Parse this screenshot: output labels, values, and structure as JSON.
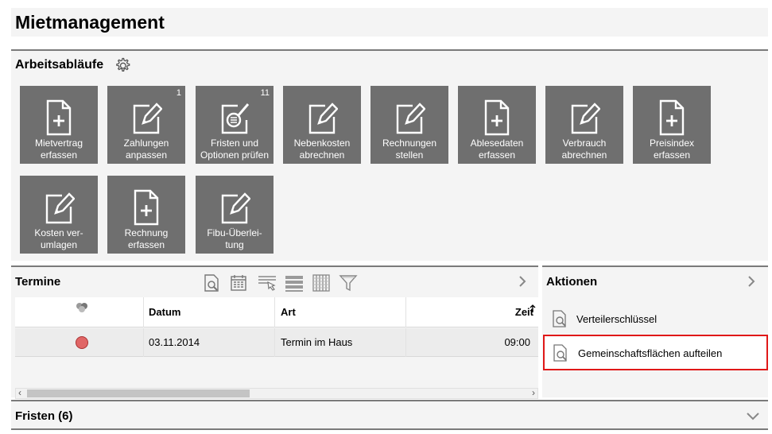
{
  "page": {
    "title": "Mietmanagement"
  },
  "workflows": {
    "title": "Arbeitsabläufe",
    "tiles": [
      {
        "label": "Mietvertrag\nerfassen",
        "icon": "doc-plus-icon",
        "badge": ""
      },
      {
        "label": "Zahlungen\nanpassen",
        "icon": "edit-icon",
        "badge": "1"
      },
      {
        "label": "Fristen und\nOptionen prüfen",
        "icon": "doc-search-icon",
        "badge": "11"
      },
      {
        "label": "Nebenkosten\nabrechnen",
        "icon": "edit-icon",
        "badge": ""
      },
      {
        "label": "Rechnungen\nstellen",
        "icon": "edit-icon",
        "badge": ""
      },
      {
        "label": "Ablesedaten\nerfassen",
        "icon": "doc-plus-icon",
        "badge": ""
      },
      {
        "label": "Verbrauch\nabrechnen",
        "icon": "edit-icon",
        "badge": ""
      },
      {
        "label": "Preisindex\nerfassen",
        "icon": "doc-plus-icon",
        "badge": ""
      },
      {
        "label": "Kosten ver-\numlagen",
        "icon": "edit-icon",
        "badge": ""
      },
      {
        "label": "Rechnung\nerfassen",
        "icon": "doc-plus-icon",
        "badge": ""
      },
      {
        "label": "Fibu-Überlei-\ntung",
        "icon": "edit-icon",
        "badge": ""
      }
    ]
  },
  "termine": {
    "title": "Termine",
    "columns": {
      "status": "",
      "datum": "Datum",
      "art": "Art",
      "zeit": "Zeit"
    },
    "rows": [
      {
        "status_color": "#e06666",
        "datum": "03.11.2014",
        "art": "Termin im Haus",
        "zeit": "09:00"
      }
    ]
  },
  "aktionen": {
    "title": "Aktionen",
    "items": [
      {
        "label": "Verteilerschlüssel"
      },
      {
        "label": "Gemeinschaftsflächen aufteilen"
      }
    ]
  },
  "fristen": {
    "title": "Fristen (6)"
  },
  "colors": {
    "tile_bg": "#6f6f6f",
    "highlight_border": "#e01818",
    "status_red": "#e06666"
  }
}
